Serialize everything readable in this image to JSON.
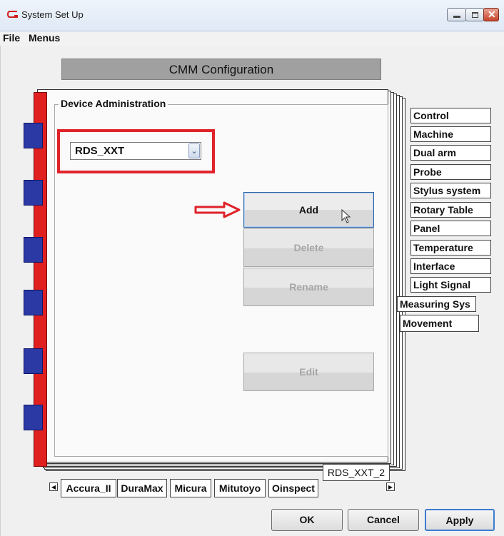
{
  "window": {
    "title": "System Set Up"
  },
  "menubar": {
    "items": [
      "File",
      "Menus"
    ]
  },
  "header": {
    "title": "CMM Configuration"
  },
  "group": {
    "label": "Device Administration"
  },
  "device_select": {
    "value": "RDS_XXT"
  },
  "actions": {
    "add": "Add",
    "delete": "Delete",
    "rename": "Rename",
    "edit": "Edit"
  },
  "right_tabs": [
    "Control",
    "Machine",
    "Dual arm",
    "Probe",
    "Stylus system",
    "Rotary Table",
    "Panel",
    "Temperature",
    "Interface",
    "Light Signal"
  ],
  "measuring_tab": "Measuring Sys",
  "movement_tab": "Movement",
  "current_page_tab": "RDS_XXT_2",
  "bottom_tabs": [
    "Accura_II",
    "DuraMax",
    "Micura",
    "Mitutoyo",
    "Oinspect"
  ],
  "footer": {
    "ok": "OK",
    "cancel": "Cancel",
    "apply": "Apply"
  },
  "colors": {
    "highlight": "#e0232a",
    "sidebar_red": "#e0201f",
    "block_blue": "#2a39a3",
    "focus_blue": "#3d7bd1"
  }
}
